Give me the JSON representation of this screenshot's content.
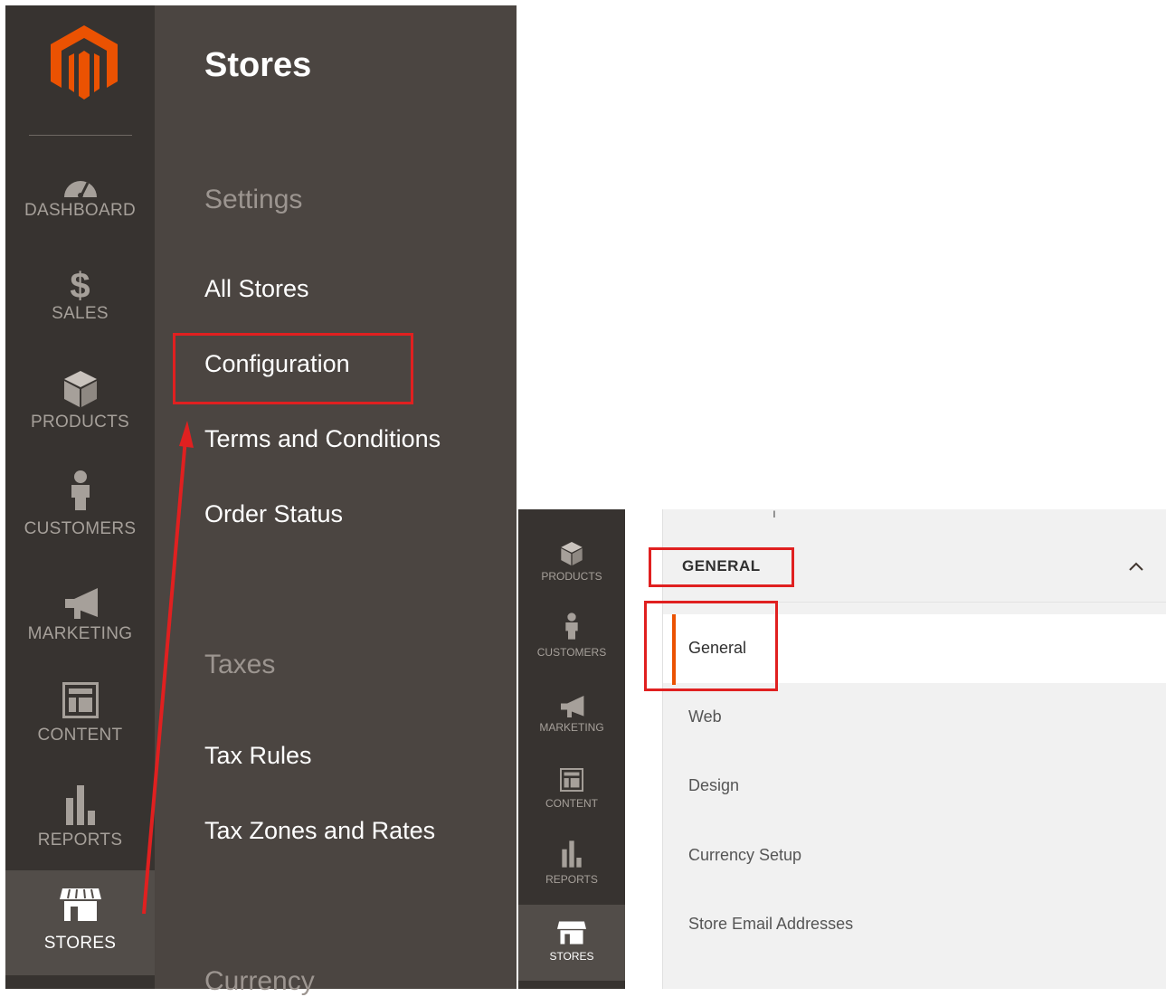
{
  "left_nav": {
    "items": [
      {
        "label": "DASHBOARD",
        "icon": "dashboard-icon"
      },
      {
        "label": "SALES",
        "icon": "dollar-icon"
      },
      {
        "label": "PRODUCTS",
        "icon": "box-icon"
      },
      {
        "label": "CUSTOMERS",
        "icon": "person-icon"
      },
      {
        "label": "MARKETING",
        "icon": "megaphone-icon"
      },
      {
        "label": "CONTENT",
        "icon": "layout-icon"
      },
      {
        "label": "REPORTS",
        "icon": "bar-chart-icon"
      },
      {
        "label": "STORES",
        "icon": "storefront-icon",
        "active": true
      }
    ]
  },
  "flyout": {
    "title": "Stores",
    "sections": [
      {
        "heading": "Settings",
        "links": [
          "All Stores",
          "Configuration",
          "Terms and Conditions",
          "Order Status"
        ]
      },
      {
        "heading": "Taxes",
        "links": [
          "Tax Rules",
          "Tax Zones and Rates"
        ]
      },
      {
        "heading": "Currency",
        "links": []
      }
    ]
  },
  "sidebar2": {
    "items": [
      {
        "label": "PRODUCTS",
        "icon": "box-icon"
      },
      {
        "label": "CUSTOMERS",
        "icon": "person-icon"
      },
      {
        "label": "MARKETING",
        "icon": "megaphone-icon"
      },
      {
        "label": "CONTENT",
        "icon": "layout-icon"
      },
      {
        "label": "REPORTS",
        "icon": "bar-chart-icon"
      },
      {
        "label": "STORES",
        "icon": "storefront-icon",
        "active": true
      }
    ]
  },
  "config": {
    "top_mark": "ı",
    "group_label": "GENERAL",
    "items": [
      "General",
      "Web",
      "Design",
      "Currency Setup",
      "Store Email Addresses"
    ]
  },
  "colors": {
    "nav_bg": "#373330",
    "flyout_bg": "#4b4541",
    "active_nav_bg": "#524d49",
    "accent_orange": "#eb5202",
    "annotation_red": "#e02020"
  }
}
